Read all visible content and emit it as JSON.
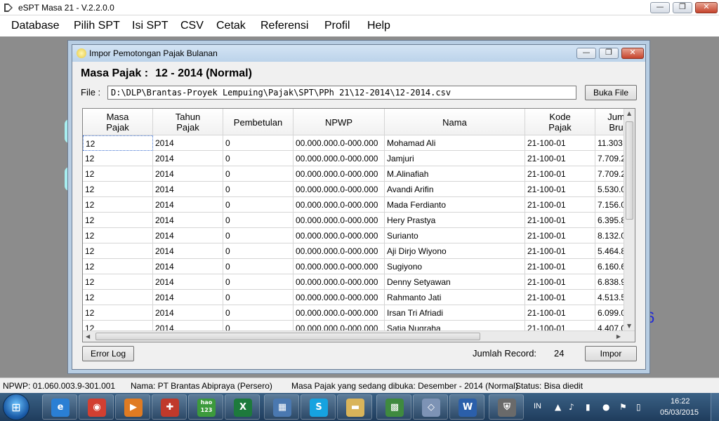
{
  "app": {
    "title": "eSPT Masa 21 - V.2.2.0.0",
    "window_controls": {
      "minimize": "—",
      "maximize": "❐",
      "close": "✕"
    }
  },
  "menu": [
    "Database",
    "Pilih SPT",
    "Isi SPT",
    "CSV",
    "Cetak",
    "Referensi",
    "Profil",
    "Help"
  ],
  "workspace": {
    "partial_number": "6"
  },
  "dialog": {
    "title": "Impor Pemotongan Pajak Bulanan",
    "masa_pajak_label": "Masa Pajak :",
    "masa_pajak_value": "12 - 2014 (Normal)",
    "file_label": "File :",
    "file_path": "D:\\DLP\\Brantas-Proyek Lempuing\\Pajak\\SPT\\PPh 21\\12-2014\\12-2014.csv",
    "buka_file_label": "Buka File",
    "error_log_label": "Error Log",
    "jumlah_record_label": "Jumlah Record:",
    "jumlah_record_value": "24",
    "impor_label": "Impor",
    "grid": {
      "columns": [
        "Masa\nPajak",
        "Tahun\nPajak",
        "Pembetulan",
        "NPWP",
        "Nama",
        "Kode\nPajak",
        "Jum\nBru"
      ],
      "rows": [
        [
          "12",
          "2014",
          "0",
          "00.000.000.0-000.000",
          "Mohamad Ali",
          "21-100-01",
          "11.303"
        ],
        [
          "12",
          "2014",
          "0",
          "00.000.000.0-000.000",
          "Jamjuri",
          "21-100-01",
          "7.709.2"
        ],
        [
          "12",
          "2014",
          "0",
          "00.000.000.0-000.000",
          "M.Alinafiah",
          "21-100-01",
          "7.709.2"
        ],
        [
          "12",
          "2014",
          "0",
          "00.000.000.0-000.000",
          "Avandi Arifin",
          "21-100-01",
          "5.530.0"
        ],
        [
          "12",
          "2014",
          "0",
          "00.000.000.0-000.000",
          "Mada Ferdianto",
          "21-100-01",
          "7.156.0"
        ],
        [
          "12",
          "2014",
          "0",
          "00.000.000.0-000.000",
          "Hery Prastya",
          "21-100-01",
          "6.395.8"
        ],
        [
          "12",
          "2014",
          "0",
          "00.000.000.0-000.000",
          "Surianto",
          "21-100-01",
          "8.132.0"
        ],
        [
          "12",
          "2014",
          "0",
          "00.000.000.0-000.000",
          "Aji Dirjo Wiyono",
          "21-100-01",
          "5.464.8"
        ],
        [
          "12",
          "2014",
          "0",
          "00.000.000.0-000.000",
          "Sugiyono",
          "21-100-01",
          "6.160.6"
        ],
        [
          "12",
          "2014",
          "0",
          "00.000.000.0-000.000",
          "Denny Setyawan",
          "21-100-01",
          "6.838.9"
        ],
        [
          "12",
          "2014",
          "0",
          "00.000.000.0-000.000",
          "Rahmanto Jati",
          "21-100-01",
          "4.513.5"
        ],
        [
          "12",
          "2014",
          "0",
          "00.000.000.0-000.000",
          "Irsan Tri Afriadi",
          "21-100-01",
          "6.099.0"
        ],
        [
          "12",
          "2014",
          "0",
          "00.000.000.0-000.000",
          "Satia Nugraha",
          "21-100-01",
          "4.407.0"
        ]
      ]
    }
  },
  "statusbar": {
    "npwp": "NPWP: 01.060.003.9-301.001",
    "nama": "Nama: PT Brantas Abipraya (Persero)",
    "masa_pajak": "Masa Pajak yang sedang dibuka: Desember - 2014 (Normal)",
    "status": "Status: Bisa diedit"
  },
  "taskbar": {
    "apps": [
      {
        "name": "internet-explorer",
        "glyph": "e",
        "color": "#2a7fd4"
      },
      {
        "name": "chrome",
        "glyph": "◉",
        "color": "#d23f31"
      },
      {
        "name": "media-player",
        "glyph": "▶",
        "color": "#e07b22"
      },
      {
        "name": "toolbox",
        "glyph": "✚",
        "color": "#c0392b"
      },
      {
        "name": "hao123",
        "glyph": "hao\n123",
        "color": "#3c9a3c"
      },
      {
        "name": "excel",
        "glyph": "X",
        "color": "#1d7a3c"
      },
      {
        "name": "control-panel",
        "glyph": "▦",
        "color": "#4a78b0"
      },
      {
        "name": "skype",
        "glyph": "S",
        "color": "#16a3e0"
      },
      {
        "name": "file-explorer",
        "glyph": "▬",
        "color": "#d9b45a"
      },
      {
        "name": "espt-app",
        "glyph": "▩",
        "color": "#3f8a3f"
      },
      {
        "name": "scanner",
        "glyph": "◇",
        "color": "#7d93b5"
      },
      {
        "name": "word",
        "glyph": "W",
        "color": "#2b5faa"
      },
      {
        "name": "security",
        "glyph": "⛨",
        "color": "#6a6a6a"
      }
    ],
    "language": "IN",
    "time": "16:22",
    "date": "05/03/2015"
  }
}
